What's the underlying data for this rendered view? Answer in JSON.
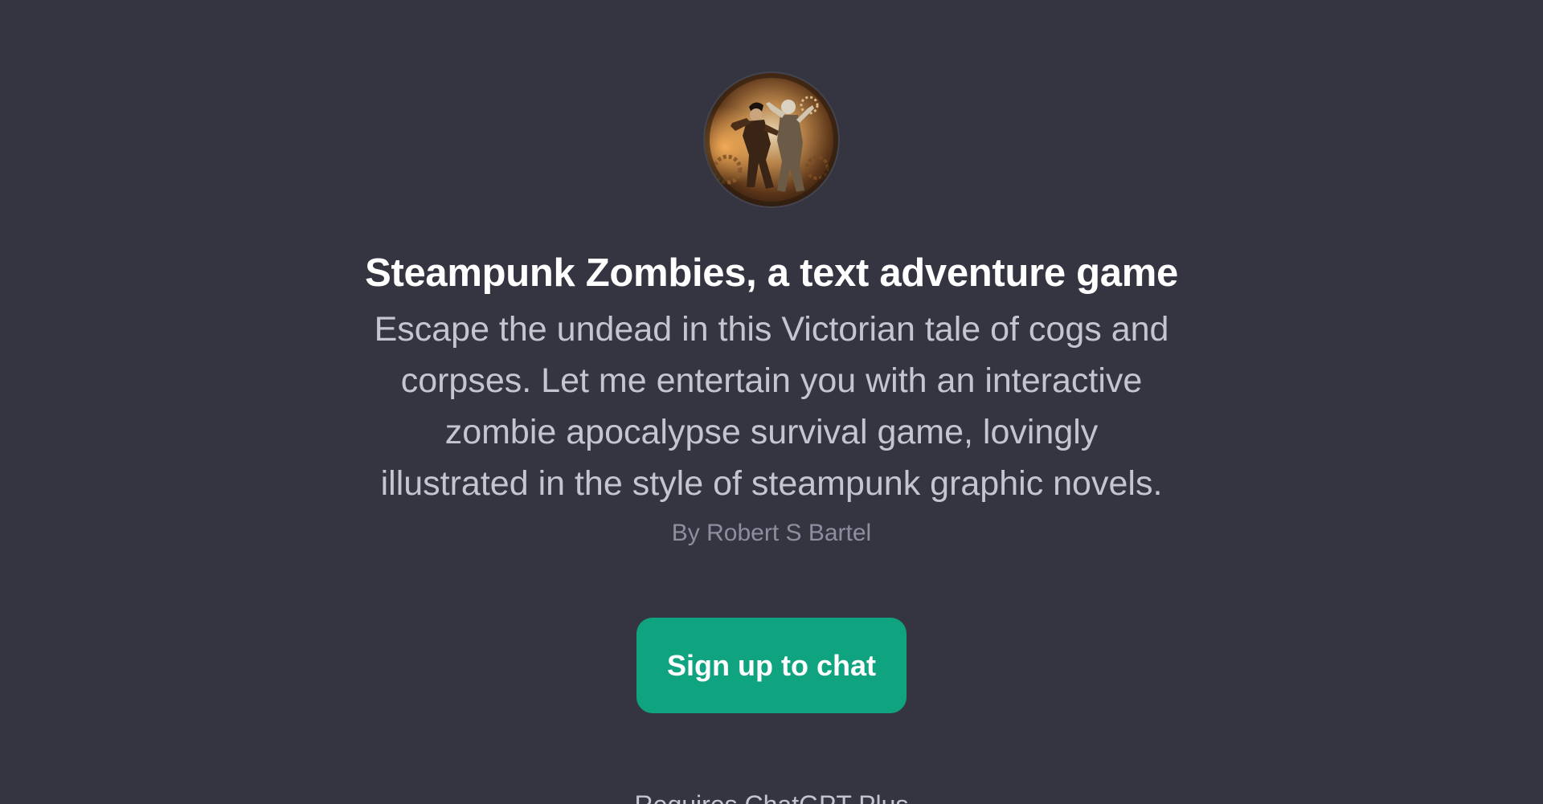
{
  "gpt": {
    "avatar_icon": "steampunk-zombies-avatar",
    "title": "Steampunk Zombies, a text adventure game",
    "description": "Escape the undead in this Victorian tale of cogs and corpses. Let me entertain you with an interactive zombie apocalypse survival game, lovingly illustrated in the style of steampunk graphic novels.",
    "author": "By Robert S Bartel"
  },
  "actions": {
    "signup_label": "Sign up to chat"
  },
  "footer": {
    "text": "Requires ChatGPT Plus"
  },
  "colors": {
    "background": "#353541",
    "button": "#10a37f",
    "title": "#ffffff",
    "description": "#c5c5d2",
    "author": "#8e8ea0"
  }
}
